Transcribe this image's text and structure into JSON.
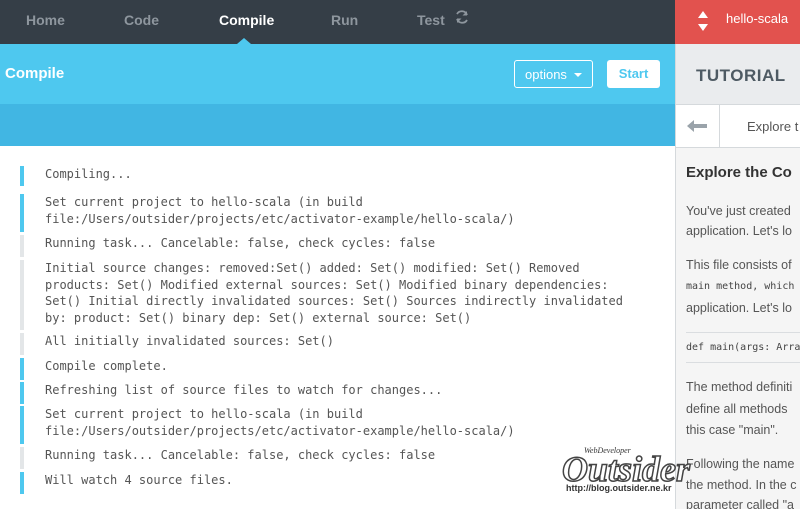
{
  "nav": {
    "tabs": [
      {
        "label": "Home"
      },
      {
        "label": "Code"
      },
      {
        "label": "Compile"
      },
      {
        "label": "Run"
      },
      {
        "label": "Test"
      }
    ],
    "active_tab": "Compile"
  },
  "project": {
    "name": "hello-scala"
  },
  "header": {
    "title": "Compile",
    "options_label": "options",
    "start_label": "Start"
  },
  "log": [
    {
      "kind": "blue",
      "text": "Compiling..."
    },
    {
      "kind": "blue",
      "text": "Set current project to hello-scala (in build\nfile:/Users/outsider/projects/etc/activator-example/hello-scala/)"
    },
    {
      "kind": "grey",
      "text": "Running task... Cancelable: false, check cycles: false"
    },
    {
      "kind": "grey",
      "text": "Initial source changes: removed:Set() added: Set() modified: Set() Removed\nproducts: Set() Modified external sources: Set() Modified binary dependencies:\nSet() Initial directly invalidated sources: Set() Sources indirectly invalidated\nby: product: Set() binary dep: Set() external source: Set()"
    },
    {
      "kind": "grey",
      "text": "All initially invalidated sources: Set()"
    },
    {
      "kind": "blue",
      "text": "Compile complete."
    },
    {
      "kind": "blue",
      "text": "Refreshing list of source files to watch for changes..."
    },
    {
      "kind": "blue",
      "text": "Set current project to hello-scala (in build\nfile:/Users/outsider/projects/etc/activator-example/hello-scala/)"
    },
    {
      "kind": "grey",
      "text": "Running task... Cancelable: false, check cycles: false"
    },
    {
      "kind": "blue",
      "text": "Will watch 4 source files."
    }
  ],
  "tutorial": {
    "title": "TUTORIAL",
    "nav_label": "Explore t",
    "heading": "Explore the Co",
    "lines": [
      "You've just created",
      "application. Let's lo",
      "This file consists of",
      "main method, which",
      "application. Let's lo",
      "def main(args: Arra",
      "The method definiti",
      "define all methods",
      "this case \"main\".",
      "Following the name",
      "the method. In the c",
      "parameter called \"a"
    ]
  },
  "watermark": {
    "brand": "Outsider",
    "tag": "WebDeveloper",
    "url": "http://blog.outsider.ne.kr"
  }
}
